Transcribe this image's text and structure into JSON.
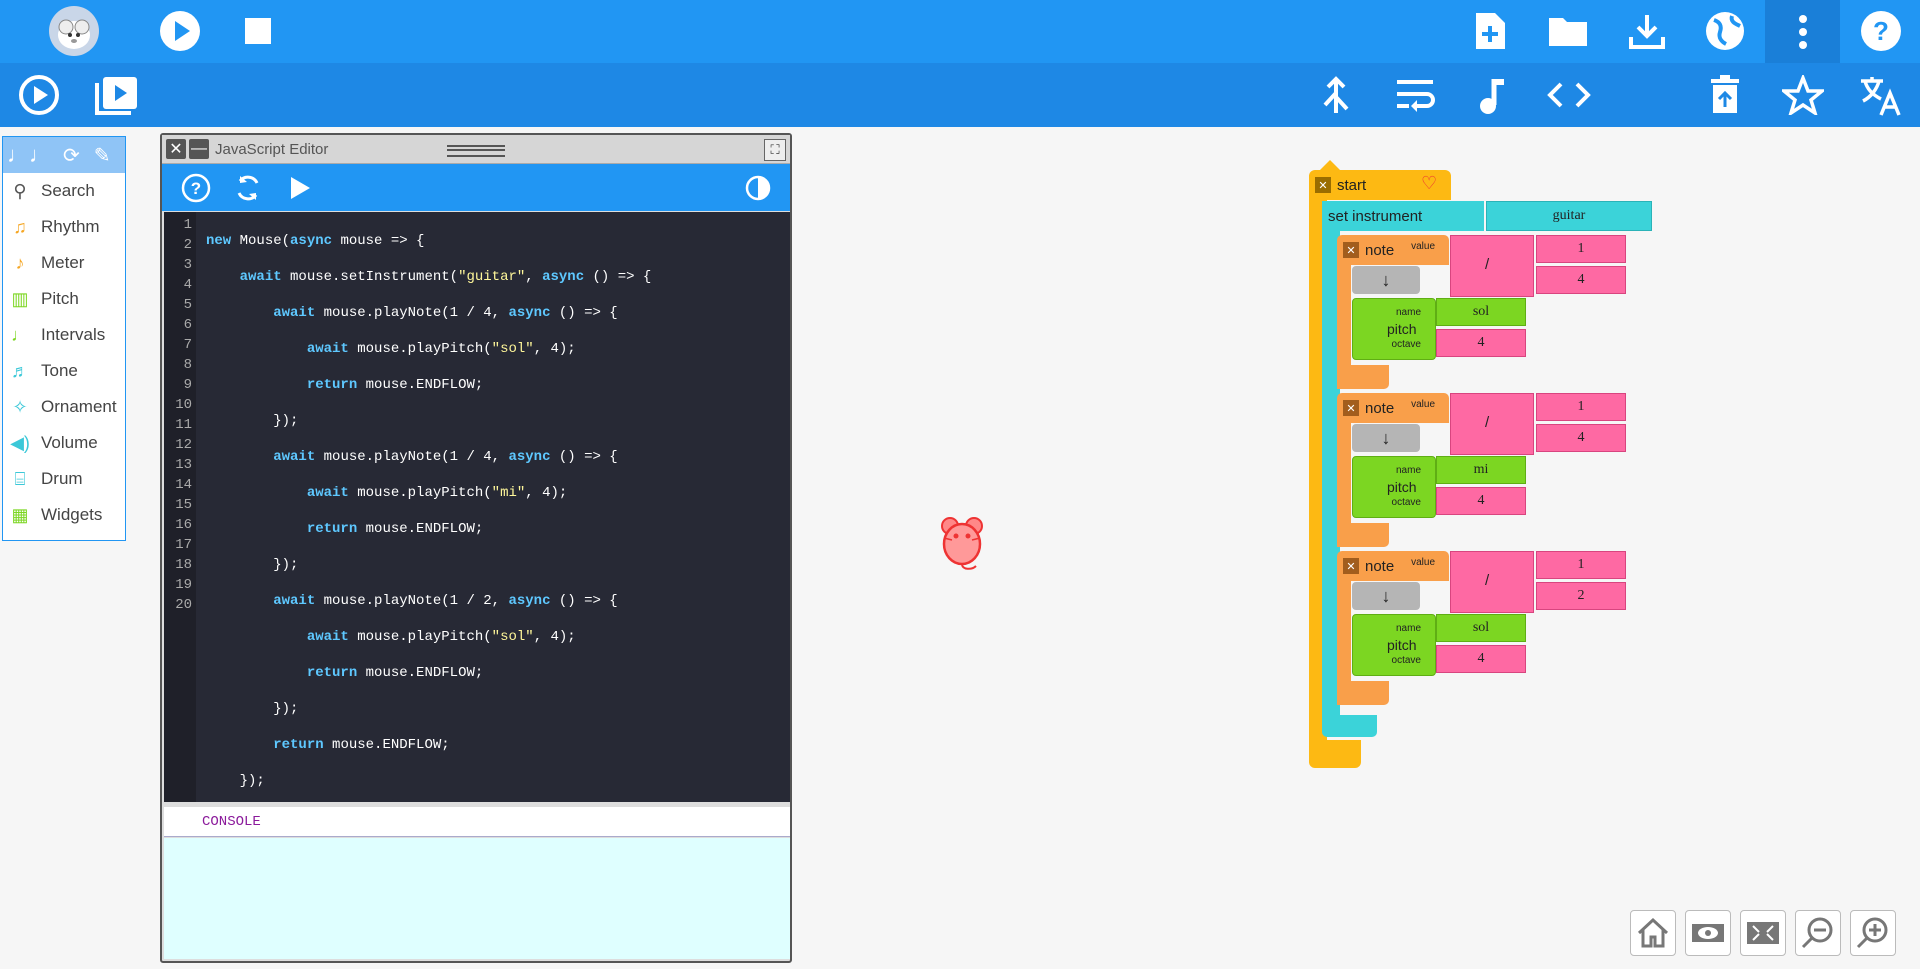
{
  "toolbar": {
    "logo": "mouse-logo",
    "top_right_icons": [
      "new-file-icon",
      "open-folder-icon",
      "save-download-icon",
      "planet-icon",
      "more-vert-icon",
      "help-icon"
    ],
    "second_left_icons": [
      "run-slow-icon",
      "step-icon"
    ],
    "second_right_icons": [
      "merge-icon",
      "wrap-icon",
      "music-note-icon",
      "code-icon",
      "delete-icon",
      "star-icon",
      "language-icon"
    ]
  },
  "palette": {
    "items": [
      {
        "label": "Search",
        "icon": "search-icon",
        "color": "#555555"
      },
      {
        "label": "Rhythm",
        "icon": "rhythm-icon",
        "color": "#f5a623"
      },
      {
        "label": "Meter",
        "icon": "meter-icon",
        "color": "#f5a623"
      },
      {
        "label": "Pitch",
        "icon": "pitch-icon",
        "color": "#7cd622"
      },
      {
        "label": "Intervals",
        "icon": "intervals-icon",
        "color": "#7cd622"
      },
      {
        "label": "Tone",
        "icon": "tone-icon",
        "color": "#3cc8d8"
      },
      {
        "label": "Ornament",
        "icon": "ornament-icon",
        "color": "#3cc8d8"
      },
      {
        "label": "Volume",
        "icon": "volume-icon",
        "color": "#3cc8d8"
      },
      {
        "label": "Drum",
        "icon": "drum-icon",
        "color": "#3cc8d8"
      },
      {
        "label": "Widgets",
        "icon": "widgets-icon",
        "color": "#7cd622"
      }
    ]
  },
  "editor": {
    "title": "JavaScript Editor",
    "console_label": "CONSOLE",
    "line_numbers": [
      "1",
      "2",
      "3",
      "4",
      "5",
      "6",
      "7",
      "8",
      "9",
      "10",
      "11",
      "12",
      "13",
      "14",
      "15",
      "16",
      "17",
      "18",
      "19",
      "20"
    ]
  },
  "blocks": {
    "start_label": "start",
    "set_instrument_label": "set instrument",
    "instrument_value": "guitar",
    "note_label": "note",
    "value_label": "value",
    "pitch_label": "pitch",
    "name_label": "name",
    "octave_label": "octave",
    "divide_symbol": "/",
    "arrow_symbol": "↓",
    "notes": [
      {
        "num": "1",
        "den": "4",
        "pitch": "sol",
        "octave": "4"
      },
      {
        "num": "1",
        "den": "4",
        "pitch": "mi",
        "octave": "4"
      },
      {
        "num": "1",
        "den": "2",
        "pitch": "sol",
        "octave": "4"
      }
    ]
  },
  "colors": {
    "toolbar": "#2196f3",
    "toolbar2": "#1e88e5",
    "start_block": "#fdb913",
    "instrument_block": "#3bd3d9",
    "note_block": "#f99f4a",
    "pitch_block": "#7cd622",
    "number_block": "#fe69a3"
  }
}
